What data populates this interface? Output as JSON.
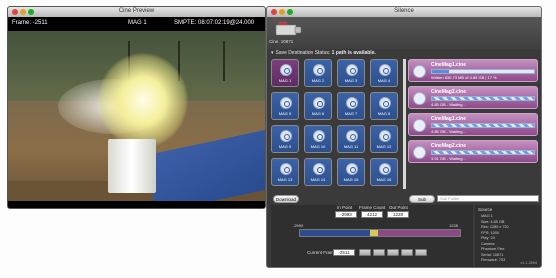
{
  "preview": {
    "title": "Cine Preview",
    "frame_label": "Frame: -2511",
    "mag_label": "MAG 1",
    "smpte_label": "SMPTE: 08:07:02:19@24.000"
  },
  "silence": {
    "title": "Silence",
    "camera_label": "Cine. 10871",
    "status_text": "Save Destination Status:",
    "status_highlight": "1 path is available.",
    "mags": [
      "MAG 1",
      "MAG 2",
      "MAG 3",
      "MAG 4",
      "MAG 5",
      "MAG 6",
      "MAG 7",
      "MAG 8",
      "MAG 9",
      "MAG 10",
      "MAG 11",
      "MAG 12",
      "MAG 13",
      "MAG 14",
      "MAG 15",
      "MAG 16"
    ],
    "jobs": [
      {
        "name": "CineMag1.cine",
        "status": "Written 830.73 MB of 4.85 GB | 17 %",
        "progress": 0.17,
        "striped": false
      },
      {
        "name": "CineMag2.cine",
        "status": "4.85 GB - Waiting...",
        "progress": 0.18,
        "striped": true
      },
      {
        "name": "CineMag1.cine",
        "status": "4.85 GB - Waiting...",
        "progress": 0.18,
        "striped": true
      },
      {
        "name": "CineMag2.cine",
        "status": "3.91 GB - Waiting...",
        "progress": 0.18,
        "striped": true
      }
    ],
    "download_label": "Download",
    "subfolder_button": "Sub Folder...",
    "subfolder_placeholder": "Sub Folder",
    "in_point_label": "In Point",
    "frame_count_label": "Frame Count",
    "out_point_label": "Out Point",
    "in_point": "-2993",
    "frame_count": "4212",
    "out_point": "1228",
    "timeline_start": "-2993",
    "timeline_end": "1228",
    "current_frame_label": "Current Frame:",
    "current_frame": "-2511",
    "info_header": "Source",
    "info_lines": [
      "MAG 1",
      "Size: 4.85 GB",
      "Res: 1280 x 720",
      "FPS: 1000",
      "Play: 24",
      "Camera",
      "Phantom Flex",
      "Serial: 10871",
      "Firmware: 703"
    ],
    "version": "v1.1.2694"
  },
  "colors": {
    "tile_blue": "#2d4f8c",
    "tile_purple": "#7b3f7e",
    "card_purple": "#8e4a8a",
    "progress_blue": "#5b8bd6"
  }
}
